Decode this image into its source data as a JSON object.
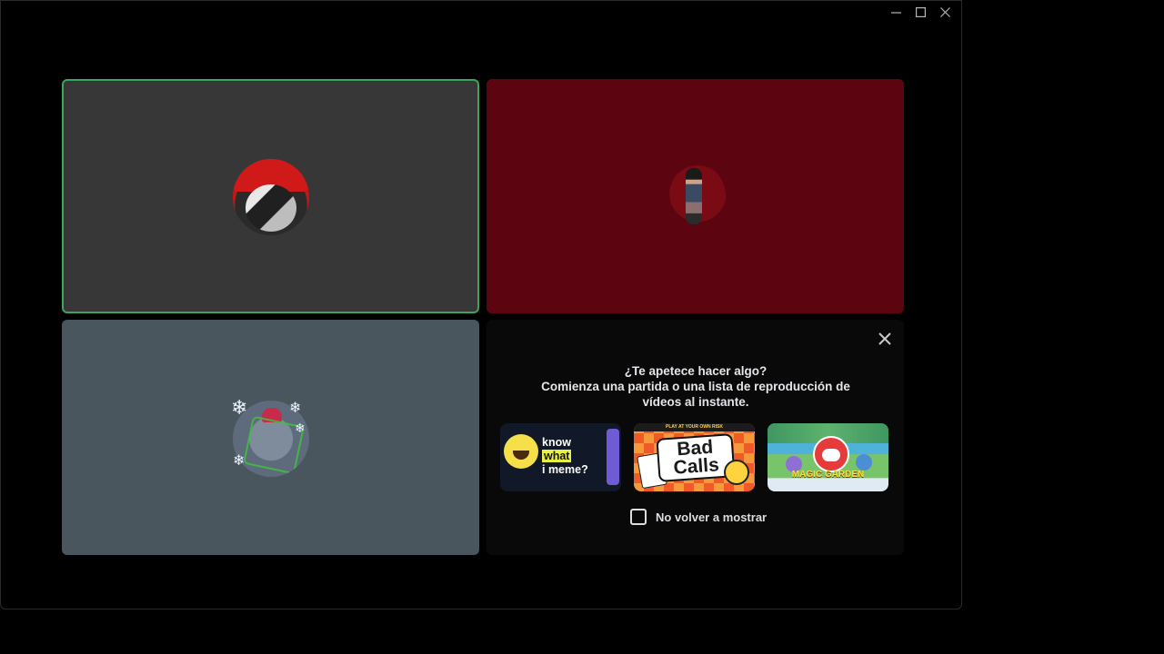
{
  "window": {
    "controls": [
      "minimize-icon",
      "maximize-icon",
      "close-icon"
    ]
  },
  "activity_panel": {
    "question": "¿Te apetece hacer algo?",
    "subtitle": "Comienza una partida o una lista de reproducción de vídeos al instante.",
    "games": [
      {
        "name": "Know What I Meme",
        "text_lines": [
          "know",
          "what",
          "i meme?"
        ]
      },
      {
        "name": "Bad Calls",
        "banner": "PLAY AT YOUR OWN RISK",
        "logo": "Bad Calls"
      },
      {
        "name": "Magic Garden",
        "logo": "MAGIC GARDEN"
      }
    ],
    "dont_show_again": "No volver a mostrar",
    "close_icon": "close-icon"
  },
  "colors": {
    "speaking_border": "#3ba55d",
    "tile1_bg": "#373737",
    "tile2_bg": "#5c0511",
    "tile3_bg": "#4a565e",
    "panel_bg": "#09090a"
  }
}
